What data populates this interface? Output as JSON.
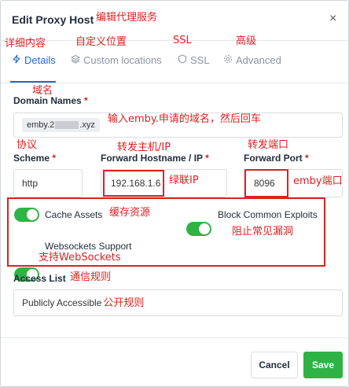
{
  "modal": {
    "title": "Edit Proxy Host",
    "close_glyph": "×"
  },
  "annotations": {
    "title_note": "编辑代理服务",
    "details_note": "详细内容",
    "custom_locations_note": "自定义位置",
    "ssl_note": "SSL",
    "advanced_note": "高级",
    "domain_note": "域名",
    "domain_input_note": "输入emby.申请的域名，然后回车",
    "scheme_note": "协议",
    "hostname_note": "转发主机/IP",
    "port_note": "转发端口",
    "ip_note": "绿联IP",
    "port_value_note": "emby端口",
    "cache_note": "缓存资源",
    "block_note": "阻止常见漏洞",
    "websockets_note": "支持WebSockets",
    "access_list_note": "通信规则",
    "access_value_note": "公开规则"
  },
  "tabs": [
    {
      "label": "Details",
      "icon": "bolt-icon",
      "active": true
    },
    {
      "label": "Custom locations",
      "icon": "layers-icon",
      "active": false
    },
    {
      "label": "SSL",
      "icon": "shield-icon",
      "active": false
    },
    {
      "label": "Advanced",
      "icon": "gear-icon",
      "active": false
    }
  ],
  "form": {
    "domain_names": {
      "label": "Domain Names",
      "required_mark": "*",
      "chip_prefix": "emby.2",
      "chip_suffix": ".xyz"
    },
    "scheme": {
      "label": "Scheme",
      "required_mark": "*",
      "value": "http"
    },
    "forward_host": {
      "label": "Forward Hostname / IP",
      "required_mark": "*",
      "value": "192.168.1.6"
    },
    "forward_port": {
      "label": "Forward Port",
      "required_mark": "*",
      "value": "8096"
    },
    "toggles": {
      "cache_assets": {
        "label": "Cache Assets",
        "on": true
      },
      "block_exploits": {
        "label": "Block Common Exploits",
        "on": true
      },
      "websockets": {
        "label": "Websockets Support",
        "on": true
      }
    },
    "access_list": {
      "label": "Access List",
      "value": "Publicly Accessible"
    }
  },
  "footer": {
    "cancel_label": "Cancel",
    "save_label": "Save"
  },
  "colors": {
    "accent": "#206bc4",
    "toggle_on": "#2fb344",
    "save_button": "#2fb344",
    "annotation_red": "#e02020"
  }
}
